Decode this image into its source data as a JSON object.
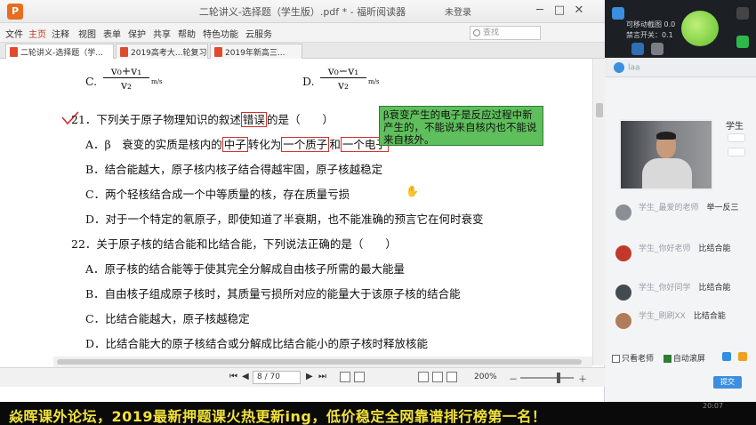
{
  "window": {
    "app_logo": "P",
    "title": "二轮讲义-选择题（学生版）.pdf * - 福昕阅读器",
    "login": "未登录",
    "controls": [
      "─",
      "□",
      "✕"
    ]
  },
  "menu": {
    "items": [
      "文件",
      "主页",
      "注释",
      "视图",
      "表单",
      "保护",
      "共享",
      "帮助",
      "特色功能",
      "云服务"
    ],
    "active_index": 1,
    "search_placeholder": "查找"
  },
  "tabs": [
    {
      "label": "二轮讲义-选择题（学...",
      "active": true
    },
    {
      "label": "2019高考大...轮复习...",
      "active": false
    },
    {
      "label": "2019年新高三...",
      "active": false
    }
  ],
  "document": {
    "opt_c_label": "C.",
    "opt_c_num": "v₀+v₁",
    "opt_c_den": "v₂",
    "opt_c_unit": "m/s",
    "opt_d_label": "D.",
    "opt_d_num": "v₀−v₁",
    "opt_d_den": "v₂",
    "opt_d_unit": "m/s",
    "q21_pre": "21．下列关于原子物理知识的叙述",
    "q21_box": "错误",
    "q21_post": "的是（　　）",
    "q21_a_pre": "A．β　衰变的实质是核内的",
    "q21_a_b1": "中子",
    "q21_a_mid": "转化为",
    "q21_a_b2": "一个质子",
    "q21_a_and": "和",
    "q21_a_b3": "一个电子",
    "q21_b": "B．结合能越大，原子核内核子结合得越牢固，原子核越稳定",
    "q21_c": "C．两个轻核结合成一个中等质量的核，存在质量亏损",
    "q21_d": "D．对于一个特定的氡原子，即使知道了半衰期，也不能准确的预言它在何时衰变",
    "q22": "22．关于原子核的结合能和比结合能，下列说法正确的是（　　）",
    "q22_a": "A．原子核的结合能等于使其完全分解成自由核子所需的最大能量",
    "q22_b": "B．自由核子组成原子核时，其质量亏损所对应的能量大于该原子核的结合能",
    "q22_c": "C．比结合能越大，原子核越稳定",
    "q22_d": "D．比结合能大的原子核结合或分解成比结合能小的原子核时释放核能",
    "note": "β衰变产生的电子是反应过程中新产生的，不能说来自核内也不能说来自核外。"
  },
  "status": {
    "page": "8 / 70",
    "zoom": "200%"
  },
  "panel": {
    "top_lines": [
      "可移动截图 0.0",
      "禁言开关：0.1"
    ],
    "user": "laa",
    "cam_label": "学生",
    "messages": [
      {
        "who": "学生_最爱的老师",
        "text": "举一反三",
        "avatar_color": "#8a8f96"
      },
      {
        "who": "学生_你好老师",
        "text": "比结合能",
        "avatar_color": "#c0392b"
      },
      {
        "who": "学生_你好同学",
        "text": "比结合能",
        "avatar_color": "#444a52"
      },
      {
        "who": "学生_刷刷XX",
        "text": "比结合能",
        "avatar_color": "#b07d5a"
      }
    ],
    "only_teacher": "只看老师",
    "auto_scroll": "自动滚屏",
    "submit": "提交"
  },
  "banner": {
    "text": "焱晖课外论坛，2019最新押题课火热更新ing，低价稳定全网靠谱排行榜第一名！",
    "color": "#f2e23a"
  },
  "clock": "20:07"
}
